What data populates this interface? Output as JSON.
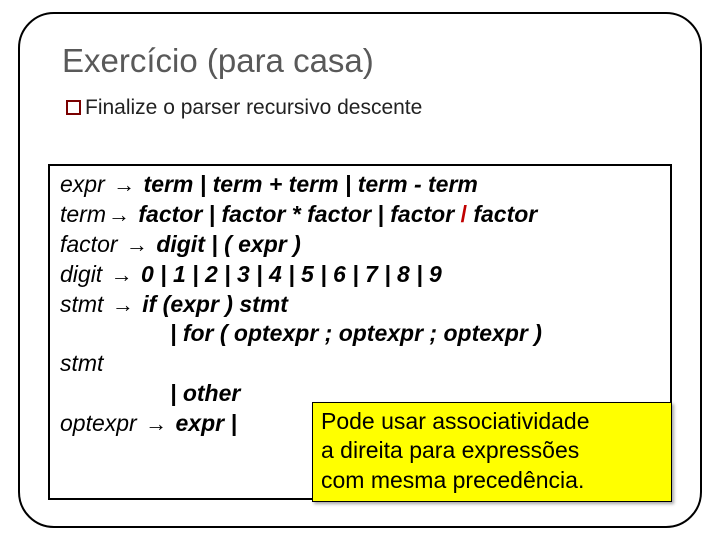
{
  "title": "Exercício (para casa)",
  "subtitle": "Finalize o parser recursivo descente",
  "grammar": {
    "expr": {
      "lhs": "expr",
      "rhs": "term | term + term | term - term"
    },
    "term": {
      "lhs": "term",
      "rhs_a": "factor | factor * factor | factor ",
      "slash": "/",
      "rhs_b": " factor"
    },
    "factor": {
      "lhs": "factor",
      "rhs": "digit | ( expr )"
    },
    "digit": {
      "lhs": "digit",
      "rhs": "0 | 1 | 2 | 3 | 4 | 5 | 6 | 7 | 8 | 9"
    },
    "stmt": {
      "lhs": "stmt",
      "rhs1": "if (expr ) stmt",
      "rhs2": "| for ( optexpr ; optexpr ; optexpr ) stmt",
      "rhs2a": "| for ( optexpr ; optexpr ; optexpr )",
      "rhs2b": "stmt",
      "rhs3": "| other"
    },
    "optexpr": {
      "lhs": "optexpr",
      "rhs": "expr |"
    }
  },
  "arrow": "→",
  "callout": {
    "l1": "Pode usar associatividade",
    "l2": "a direita para expressões",
    "l3": "com mesma precedência."
  }
}
